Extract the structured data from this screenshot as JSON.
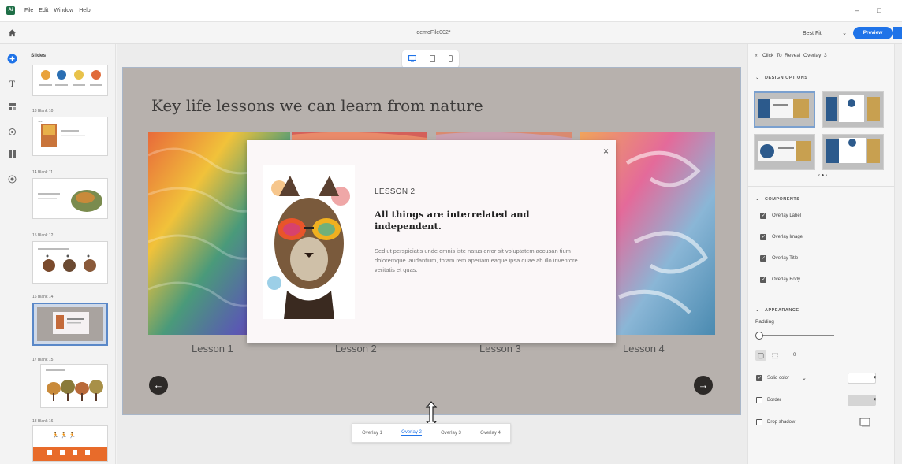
{
  "titlebar": {
    "app_icon_letter": "Ai",
    "menu": [
      "File",
      "Edit",
      "Window",
      "Help"
    ],
    "minimize": "–",
    "maximize": "□"
  },
  "header": {
    "file_title": "demoFile002*",
    "zoom_label": "Best Fit",
    "preview_label": "Preview",
    "more_label": "⋯"
  },
  "tools": [
    "plus-circle-icon",
    "text-icon",
    "layout-icon",
    "interaction-icon",
    "grid-icon",
    "circle-dot-icon"
  ],
  "slides_panel": {
    "heading": "Slides",
    "thumbs": [
      {
        "label": ""
      },
      {
        "label": "13  Blank 10"
      },
      {
        "label": "14  Blank 11"
      },
      {
        "label": "15  Blank 12"
      },
      {
        "label": "16  Blank 14"
      },
      {
        "label": "17  Blank 15"
      },
      {
        "label": "18  Blank 16"
      }
    ]
  },
  "stage": {
    "slide_title": "Key life lessons we can learn from nature",
    "lessons": [
      "Lesson 1",
      "Lesson 2",
      "Lesson 3",
      "Lesson 4"
    ],
    "prev_arrow": "←",
    "next_arrow": "→",
    "overlay": {
      "close": "×",
      "label": "LESSON 2",
      "title": "All things are interrelated and independent.",
      "body": "Sed ut perspiciatis unde omnis iste natus error sit voluptatem accusan tium doloremque laudantium, totam rem aperiam eaque ipsa quae ab illo inventore veritatis et quas."
    },
    "overlay_tabs": [
      "Overlay 1",
      "Overlay 2",
      "Overlay 3",
      "Overlay 4"
    ],
    "active_tab": "Overlay 2"
  },
  "right_panel": {
    "breadcrumb": "Click_To_Reveal_Overlay_3",
    "design_options_heading": "DESIGN OPTIONS",
    "pager": "‹ ● ›",
    "components_heading": "COMPONENTS",
    "components": [
      {
        "label": "Overlay Label",
        "checked": true
      },
      {
        "label": "Overlay Image",
        "checked": true
      },
      {
        "label": "Overlay Title",
        "checked": true
      },
      {
        "label": "Overlay Body",
        "checked": true
      }
    ],
    "appearance_heading": "APPEARANCE",
    "padding_label": "Padding",
    "padding_value": "0",
    "solid_color_label": "Solid color",
    "solid_color_checked": true,
    "border_label": "Border",
    "border_checked": false,
    "drop_shadow_label": "Drop shadow",
    "drop_shadow_checked": false
  },
  "colors": {
    "accent": "#1f73e8",
    "slide_bg": "#b7b1ad",
    "overlay_bg": "#fbf7f8"
  }
}
